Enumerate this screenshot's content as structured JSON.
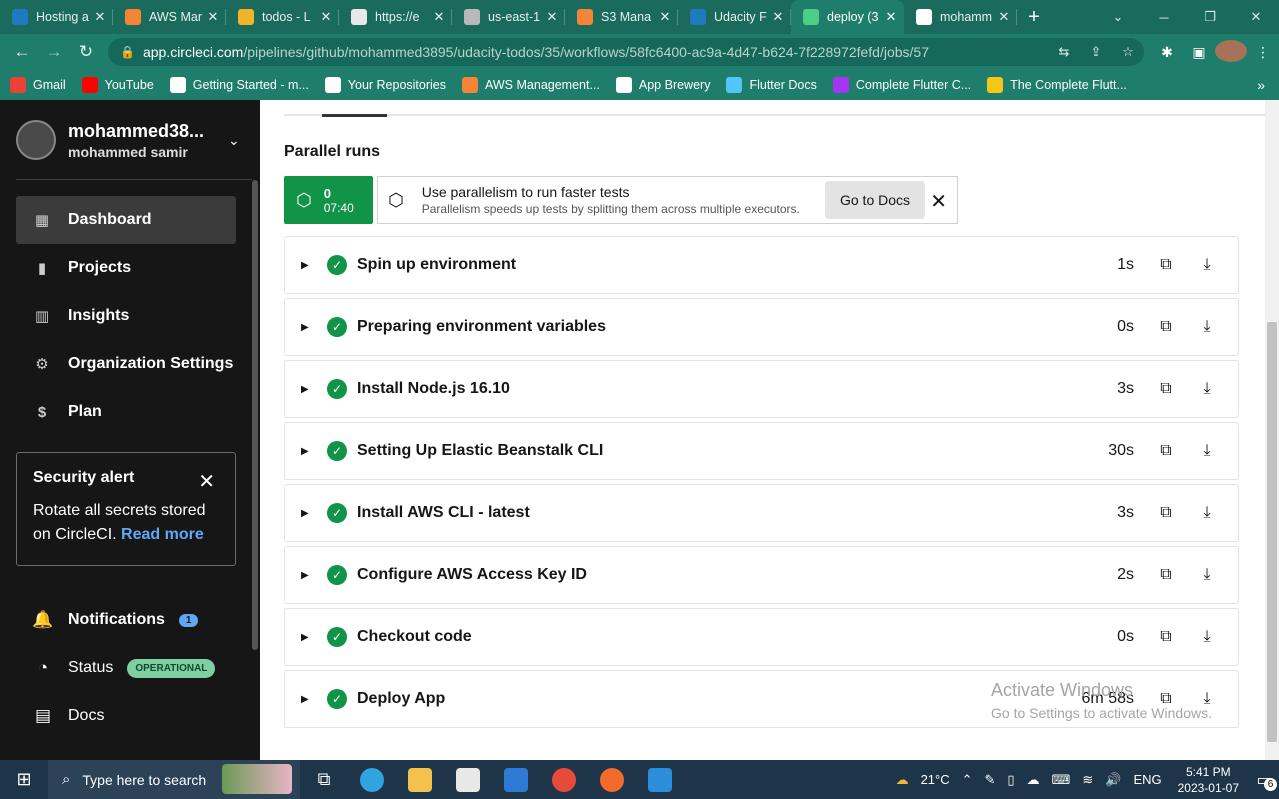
{
  "browser": {
    "tabs": [
      {
        "title": "Hosting a",
        "color": "#1f7ac1",
        "active": false
      },
      {
        "title": "AWS Mar",
        "color": "#f58536",
        "active": false
      },
      {
        "title": "todos - L",
        "color": "#f0b429",
        "active": false
      },
      {
        "title": "https://e",
        "color": "#e8e8e8",
        "active": false
      },
      {
        "title": "us-east-1",
        "color": "#b8b8b8",
        "active": false
      },
      {
        "title": "S3 Mana",
        "color": "#f58536",
        "active": false
      },
      {
        "title": "Udacity F",
        "color": "#1f7ac1",
        "active": false
      },
      {
        "title": "deploy (3",
        "color": "#4ccf82",
        "active": true
      },
      {
        "title": "mohamm",
        "color": "#ffffff",
        "active": false
      }
    ],
    "tab_close_glyph": "✕",
    "new_tab_glyph": "+",
    "url_host": "app.circleci.com",
    "url_path": "/pipelines/github/mohammed3895/udacity-todos/35/workflows/58fc6400-ac9a-4d47-b624-7f228972fefd/jobs/57",
    "bookmarks": [
      {
        "label": "Gmail",
        "color": "#ea4335"
      },
      {
        "label": "YouTube",
        "color": "#ff0000"
      },
      {
        "label": "Getting Started - m...",
        "color": "#ffffff"
      },
      {
        "label": "Your Repositories",
        "color": "#ffffff"
      },
      {
        "label": "AWS Management...",
        "color": "#f58536"
      },
      {
        "label": "App Brewery",
        "color": "#ffffff"
      },
      {
        "label": "Flutter Docs",
        "color": "#54c5f8"
      },
      {
        "label": "Complete Flutter C...",
        "color": "#a435f0"
      },
      {
        "label": "The Complete Flutt...",
        "color": "#f5c518"
      }
    ]
  },
  "sidebar": {
    "account_name": "mohammed38...",
    "account_sub": "mohammed samir",
    "nav": [
      {
        "label": "Dashboard",
        "icon": "▦",
        "active": true
      },
      {
        "label": "Projects",
        "icon": "▮",
        "active": false
      },
      {
        "label": "Insights",
        "icon": "▥",
        "active": false
      },
      {
        "label": "Organization Settings",
        "icon": "⚙",
        "active": false
      },
      {
        "label": "Plan",
        "icon": "$",
        "active": false
      }
    ],
    "alert": {
      "title": "Security alert",
      "body": "Rotate all secrets stored on CircleCI.",
      "link": "Read more"
    },
    "notifications_label": "Notifications",
    "notifications_count": "1",
    "status_label": "Status",
    "status_badge": "OPERATIONAL",
    "docs_label": "Docs"
  },
  "main": {
    "parallel_title": "Parallel runs",
    "run_index": "0",
    "run_time": "07:40",
    "banner_title": "Use parallelism to run faster tests",
    "banner_sub": "Parallelism speeds up tests by splitting them across multiple executors.",
    "go_to_docs": "Go to Docs",
    "steps": [
      {
        "name": "Spin up environment",
        "duration": "1s"
      },
      {
        "name": "Preparing environment variables",
        "duration": "0s"
      },
      {
        "name": "Install Node.js 16.10",
        "duration": "3s"
      },
      {
        "name": "Setting Up Elastic Beanstalk CLI",
        "duration": "30s"
      },
      {
        "name": "Install AWS CLI - latest",
        "duration": "3s"
      },
      {
        "name": "Configure AWS Access Key ID",
        "duration": "2s"
      },
      {
        "name": "Checkout code",
        "duration": "0s"
      },
      {
        "name": "Deploy App",
        "duration": "6m 58s"
      }
    ],
    "watermark_line1": "Activate Windows",
    "watermark_line2": "Go to Settings to activate Windows."
  },
  "taskbar": {
    "search_placeholder": "Type here to search",
    "temperature": "21°C",
    "language": "ENG",
    "time": "5:41 PM",
    "date": "2023-01-07",
    "notification_count": "6"
  }
}
